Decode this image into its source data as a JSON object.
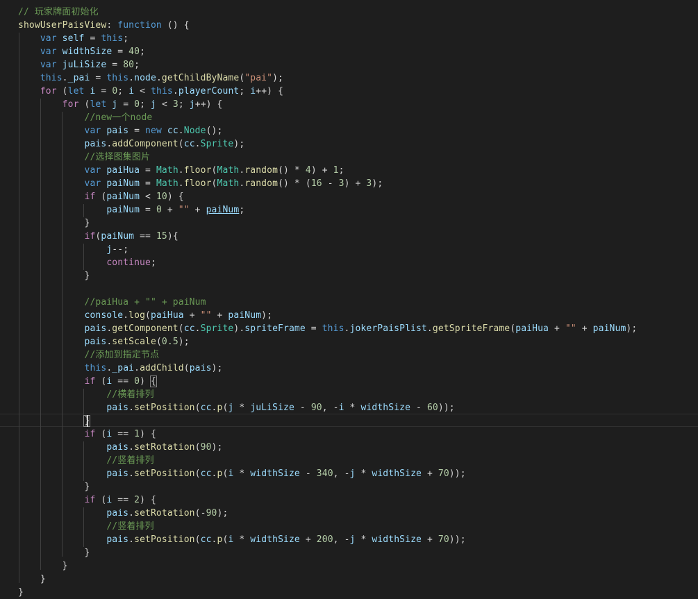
{
  "editor": {
    "language": "javascript",
    "theme_colors": {
      "background": "#1e1e1e",
      "comment": "#6a9955",
      "keyword": "#569cd6",
      "control": "#c586c0",
      "variable": "#9cdcfe",
      "function": "#dcdcaa",
      "class": "#4ec9b0",
      "number": "#b5cea8",
      "string": "#ce9178",
      "text": "#d4d4d4"
    },
    "lines": [
      [
        [
          "cm",
          "// 玩家牌面初始化"
        ]
      ],
      [
        [
          "fn",
          "showUserPaisView"
        ],
        [
          "pn",
          ": "
        ],
        [
          "kw",
          "function"
        ],
        [
          "pn",
          " () {"
        ]
      ],
      [
        [
          "pn",
          "    "
        ],
        [
          "kw",
          "var"
        ],
        [
          "pn",
          " "
        ],
        [
          "var",
          "self"
        ],
        [
          "pn",
          " = "
        ],
        [
          "kw",
          "this"
        ],
        [
          "pn",
          ";"
        ]
      ],
      [
        [
          "pn",
          "    "
        ],
        [
          "kw",
          "var"
        ],
        [
          "pn",
          " "
        ],
        [
          "var",
          "widthSize"
        ],
        [
          "pn",
          " = "
        ],
        [
          "num",
          "40"
        ],
        [
          "pn",
          ";"
        ]
      ],
      [
        [
          "pn",
          "    "
        ],
        [
          "kw",
          "var"
        ],
        [
          "pn",
          " "
        ],
        [
          "var",
          "juLiSize"
        ],
        [
          "pn",
          " = "
        ],
        [
          "num",
          "80"
        ],
        [
          "pn",
          ";"
        ]
      ],
      [
        [
          "pn",
          "    "
        ],
        [
          "kw",
          "this"
        ],
        [
          "pn",
          "."
        ],
        [
          "var",
          "_pai"
        ],
        [
          "pn",
          " = "
        ],
        [
          "kw",
          "this"
        ],
        [
          "pn",
          "."
        ],
        [
          "var",
          "node"
        ],
        [
          "pn",
          "."
        ],
        [
          "fn",
          "getChildByName"
        ],
        [
          "pn",
          "("
        ],
        [
          "str",
          "\"pai\""
        ],
        [
          "pn",
          ");"
        ]
      ],
      [
        [
          "pn",
          "    "
        ],
        [
          "ctl",
          "for"
        ],
        [
          "pn",
          " ("
        ],
        [
          "kw",
          "let"
        ],
        [
          "pn",
          " "
        ],
        [
          "var",
          "i"
        ],
        [
          "pn",
          " = "
        ],
        [
          "num",
          "0"
        ],
        [
          "pn",
          "; "
        ],
        [
          "var",
          "i"
        ],
        [
          "pn",
          " < "
        ],
        [
          "kw",
          "this"
        ],
        [
          "pn",
          "."
        ],
        [
          "var",
          "playerCount"
        ],
        [
          "pn",
          "; "
        ],
        [
          "var",
          "i"
        ],
        [
          "pn",
          "++) {"
        ]
      ],
      [
        [
          "pn",
          "        "
        ],
        [
          "ctl",
          "for"
        ],
        [
          "pn",
          " ("
        ],
        [
          "kw",
          "let"
        ],
        [
          "pn",
          " "
        ],
        [
          "var",
          "j"
        ],
        [
          "pn",
          " = "
        ],
        [
          "num",
          "0"
        ],
        [
          "pn",
          "; "
        ],
        [
          "var",
          "j"
        ],
        [
          "pn",
          " < "
        ],
        [
          "num",
          "3"
        ],
        [
          "pn",
          "; "
        ],
        [
          "var",
          "j"
        ],
        [
          "pn",
          "++) {"
        ]
      ],
      [
        [
          "pn",
          "            "
        ],
        [
          "cm",
          "//new一个node"
        ]
      ],
      [
        [
          "pn",
          "            "
        ],
        [
          "kw",
          "var"
        ],
        [
          "pn",
          " "
        ],
        [
          "var",
          "pais"
        ],
        [
          "pn",
          " = "
        ],
        [
          "kw",
          "new"
        ],
        [
          "pn",
          " "
        ],
        [
          "var",
          "cc"
        ],
        [
          "pn",
          "."
        ],
        [
          "cls",
          "Node"
        ],
        [
          "pn",
          "();"
        ]
      ],
      [
        [
          "pn",
          "            "
        ],
        [
          "var",
          "pais"
        ],
        [
          "pn",
          "."
        ],
        [
          "fn",
          "addComponent"
        ],
        [
          "pn",
          "("
        ],
        [
          "var",
          "cc"
        ],
        [
          "pn",
          "."
        ],
        [
          "cls",
          "Sprite"
        ],
        [
          "pn",
          ");"
        ]
      ],
      [
        [
          "pn",
          "            "
        ],
        [
          "cm",
          "//选择图集图片"
        ]
      ],
      [
        [
          "pn",
          "            "
        ],
        [
          "kw",
          "var"
        ],
        [
          "pn",
          " "
        ],
        [
          "var",
          "paiHua"
        ],
        [
          "pn",
          " = "
        ],
        [
          "cls",
          "Math"
        ],
        [
          "pn",
          "."
        ],
        [
          "fn",
          "floor"
        ],
        [
          "pn",
          "("
        ],
        [
          "cls",
          "Math"
        ],
        [
          "pn",
          "."
        ],
        [
          "fn",
          "random"
        ],
        [
          "pn",
          "() * "
        ],
        [
          "num",
          "4"
        ],
        [
          "pn",
          ") + "
        ],
        [
          "num",
          "1"
        ],
        [
          "pn",
          ";"
        ]
      ],
      [
        [
          "pn",
          "            "
        ],
        [
          "kw",
          "var"
        ],
        [
          "pn",
          " "
        ],
        [
          "var",
          "paiNum"
        ],
        [
          "pn",
          " = "
        ],
        [
          "cls",
          "Math"
        ],
        [
          "pn",
          "."
        ],
        [
          "fn",
          "floor"
        ],
        [
          "pn",
          "("
        ],
        [
          "cls",
          "Math"
        ],
        [
          "pn",
          "."
        ],
        [
          "fn",
          "random"
        ],
        [
          "pn",
          "() * ("
        ],
        [
          "num",
          "16"
        ],
        [
          "pn",
          " - "
        ],
        [
          "num",
          "3"
        ],
        [
          "pn",
          ") + "
        ],
        [
          "num",
          "3"
        ],
        [
          "pn",
          ");"
        ]
      ],
      [
        [
          "pn",
          "            "
        ],
        [
          "ctl",
          "if"
        ],
        [
          "pn",
          " ("
        ],
        [
          "var",
          "paiNum"
        ],
        [
          "pn",
          " < "
        ],
        [
          "num",
          "10"
        ],
        [
          "pn",
          ") {"
        ]
      ],
      [
        [
          "pn",
          "                "
        ],
        [
          "var",
          "paiNum"
        ],
        [
          "pn",
          " = "
        ],
        [
          "num",
          "0"
        ],
        [
          "pn",
          " + "
        ],
        [
          "str",
          "\"\""
        ],
        [
          "pn",
          " + "
        ],
        [
          "var",
          "paiNum",
          "ul"
        ],
        [
          "pn",
          ";"
        ]
      ],
      [
        [
          "pn",
          "            }"
        ]
      ],
      [
        [
          "pn",
          "            "
        ],
        [
          "ctl",
          "if"
        ],
        [
          "pn",
          "("
        ],
        [
          "var",
          "paiNum"
        ],
        [
          "pn",
          " == "
        ],
        [
          "num",
          "15"
        ],
        [
          "pn",
          "){"
        ]
      ],
      [
        [
          "pn",
          "                "
        ],
        [
          "var",
          "j"
        ],
        [
          "pn",
          "--;"
        ]
      ],
      [
        [
          "pn",
          "                "
        ],
        [
          "ctl",
          "continue"
        ],
        [
          "pn",
          ";"
        ]
      ],
      [
        [
          "pn",
          "            }"
        ]
      ],
      [
        [
          "pn",
          ""
        ]
      ],
      [
        [
          "pn",
          "            "
        ],
        [
          "cm",
          "//paiHua + \"\" + paiNum"
        ]
      ],
      [
        [
          "pn",
          "            "
        ],
        [
          "var",
          "console"
        ],
        [
          "pn",
          "."
        ],
        [
          "fn",
          "log"
        ],
        [
          "pn",
          "("
        ],
        [
          "var",
          "paiHua"
        ],
        [
          "pn",
          " + "
        ],
        [
          "str",
          "\"\""
        ],
        [
          "pn",
          " + "
        ],
        [
          "var",
          "paiNum"
        ],
        [
          "pn",
          ");"
        ]
      ],
      [
        [
          "pn",
          "            "
        ],
        [
          "var",
          "pais"
        ],
        [
          "pn",
          "."
        ],
        [
          "fn",
          "getComponent"
        ],
        [
          "pn",
          "("
        ],
        [
          "var",
          "cc"
        ],
        [
          "pn",
          "."
        ],
        [
          "cls",
          "Sprite"
        ],
        [
          "pn",
          ")."
        ],
        [
          "var",
          "spriteFrame"
        ],
        [
          "pn",
          " = "
        ],
        [
          "kw",
          "this"
        ],
        [
          "pn",
          "."
        ],
        [
          "var",
          "jokerPaisPlist"
        ],
        [
          "pn",
          "."
        ],
        [
          "fn",
          "getSpriteFrame"
        ],
        [
          "pn",
          "("
        ],
        [
          "var",
          "paiHua"
        ],
        [
          "pn",
          " + "
        ],
        [
          "str",
          "\"\""
        ],
        [
          "pn",
          " + "
        ],
        [
          "var",
          "paiNum"
        ],
        [
          "pn",
          ");"
        ]
      ],
      [
        [
          "pn",
          "            "
        ],
        [
          "var",
          "pais"
        ],
        [
          "pn",
          "."
        ],
        [
          "fn",
          "setScale"
        ],
        [
          "pn",
          "("
        ],
        [
          "num",
          "0.5"
        ],
        [
          "pn",
          ");"
        ]
      ],
      [
        [
          "pn",
          "            "
        ],
        [
          "cm",
          "//添加到指定节点"
        ]
      ],
      [
        [
          "pn",
          "            "
        ],
        [
          "kw",
          "this"
        ],
        [
          "pn",
          "."
        ],
        [
          "var",
          "_pai"
        ],
        [
          "pn",
          "."
        ],
        [
          "fn",
          "addChild"
        ],
        [
          "pn",
          "("
        ],
        [
          "var",
          "pais"
        ],
        [
          "pn",
          ");"
        ]
      ],
      [
        [
          "pn",
          "            "
        ],
        [
          "ctl",
          "if"
        ],
        [
          "pn",
          " ("
        ],
        [
          "var",
          "i"
        ],
        [
          "pn",
          " == "
        ],
        [
          "num",
          "0"
        ],
        [
          "pn",
          ") "
        ],
        [
          "pn",
          "{",
          "bm"
        ]
      ],
      [
        [
          "pn",
          "                "
        ],
        [
          "cm",
          "//横着排列"
        ]
      ],
      [
        [
          "pn",
          "                "
        ],
        [
          "var",
          "pais"
        ],
        [
          "pn",
          "."
        ],
        [
          "fn",
          "setPosition"
        ],
        [
          "pn",
          "("
        ],
        [
          "var",
          "cc"
        ],
        [
          "pn",
          "."
        ],
        [
          "fn",
          "p"
        ],
        [
          "pn",
          "("
        ],
        [
          "var",
          "j"
        ],
        [
          "pn",
          " * "
        ],
        [
          "var",
          "juLiSize"
        ],
        [
          "pn",
          " - "
        ],
        [
          "num",
          "90"
        ],
        [
          "pn",
          ", -"
        ],
        [
          "var",
          "i"
        ],
        [
          "pn",
          " * "
        ],
        [
          "var",
          "widthSize"
        ],
        [
          "pn",
          " - "
        ],
        [
          "num",
          "60"
        ],
        [
          "pn",
          "));"
        ]
      ],
      [
        [
          "pn",
          "            "
        ],
        [
          "pn",
          "}",
          "bm"
        ]
      ],
      [
        [
          "pn",
          "            "
        ],
        [
          "ctl",
          "if"
        ],
        [
          "pn",
          " ("
        ],
        [
          "var",
          "i"
        ],
        [
          "pn",
          " == "
        ],
        [
          "num",
          "1"
        ],
        [
          "pn",
          ") {"
        ]
      ],
      [
        [
          "pn",
          "                "
        ],
        [
          "var",
          "pais"
        ],
        [
          "pn",
          "."
        ],
        [
          "fn",
          "setRotation"
        ],
        [
          "pn",
          "("
        ],
        [
          "num",
          "90"
        ],
        [
          "pn",
          ");"
        ]
      ],
      [
        [
          "pn",
          "                "
        ],
        [
          "cm",
          "//竖着排列"
        ]
      ],
      [
        [
          "pn",
          "                "
        ],
        [
          "var",
          "pais"
        ],
        [
          "pn",
          "."
        ],
        [
          "fn",
          "setPosition"
        ],
        [
          "pn",
          "("
        ],
        [
          "var",
          "cc"
        ],
        [
          "pn",
          "."
        ],
        [
          "fn",
          "p"
        ],
        [
          "pn",
          "("
        ],
        [
          "var",
          "i"
        ],
        [
          "pn",
          " * "
        ],
        [
          "var",
          "widthSize"
        ],
        [
          "pn",
          " - "
        ],
        [
          "num",
          "340"
        ],
        [
          "pn",
          ", -"
        ],
        [
          "var",
          "j"
        ],
        [
          "pn",
          " * "
        ],
        [
          "var",
          "widthSize"
        ],
        [
          "pn",
          " + "
        ],
        [
          "num",
          "70"
        ],
        [
          "pn",
          "));"
        ]
      ],
      [
        [
          "pn",
          "            }"
        ]
      ],
      [
        [
          "pn",
          "            "
        ],
        [
          "ctl",
          "if"
        ],
        [
          "pn",
          " ("
        ],
        [
          "var",
          "i"
        ],
        [
          "pn",
          " == "
        ],
        [
          "num",
          "2"
        ],
        [
          "pn",
          ") {"
        ]
      ],
      [
        [
          "pn",
          "                "
        ],
        [
          "var",
          "pais"
        ],
        [
          "pn",
          "."
        ],
        [
          "fn",
          "setRotation"
        ],
        [
          "pn",
          "(-"
        ],
        [
          "num",
          "90"
        ],
        [
          "pn",
          ");"
        ]
      ],
      [
        [
          "pn",
          "                "
        ],
        [
          "cm",
          "//竖着排列"
        ]
      ],
      [
        [
          "pn",
          "                "
        ],
        [
          "var",
          "pais"
        ],
        [
          "pn",
          "."
        ],
        [
          "fn",
          "setPosition"
        ],
        [
          "pn",
          "("
        ],
        [
          "var",
          "cc"
        ],
        [
          "pn",
          "."
        ],
        [
          "fn",
          "p"
        ],
        [
          "pn",
          "("
        ],
        [
          "var",
          "i"
        ],
        [
          "pn",
          " * "
        ],
        [
          "var",
          "widthSize"
        ],
        [
          "pn",
          " + "
        ],
        [
          "num",
          "200"
        ],
        [
          "pn",
          ", -"
        ],
        [
          "var",
          "j"
        ],
        [
          "pn",
          " * "
        ],
        [
          "var",
          "widthSize"
        ],
        [
          "pn",
          " + "
        ],
        [
          "num",
          "70"
        ],
        [
          "pn",
          "));"
        ]
      ],
      [
        [
          "pn",
          "            }"
        ]
      ],
      [
        [
          "pn",
          "        }"
        ]
      ],
      [
        [
          "pn",
          "    }"
        ]
      ],
      [
        [
          "pn",
          "}"
        ]
      ]
    ]
  }
}
